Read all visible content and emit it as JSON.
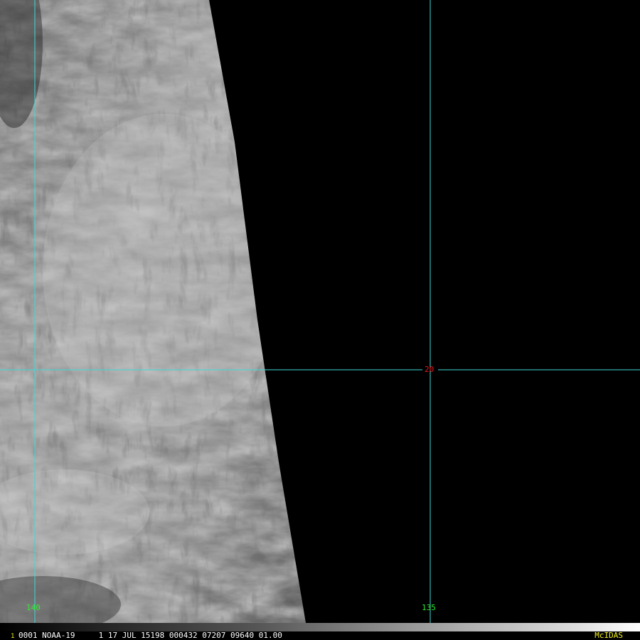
{
  "colors": {
    "grid_line": "#3fd8d8",
    "longitude_label": "#2ee82e",
    "latitude_label": "#e81818",
    "brand": "#f0f020",
    "frame_number": "#f0f020",
    "background": "#000000"
  },
  "grid": {
    "longitudes": [
      {
        "label": "140"
      },
      {
        "label": "135"
      }
    ],
    "latitudes": [
      {
        "label": "20"
      }
    ]
  },
  "status_bar": {
    "frame_number": "1",
    "header_text": "0001 NOAA-19     1 17 JUL 15198 000432 07207 09640 01.00",
    "brand": "McIDAS"
  },
  "imagery": {
    "description_icon": "satellite-cloud-imagery"
  }
}
